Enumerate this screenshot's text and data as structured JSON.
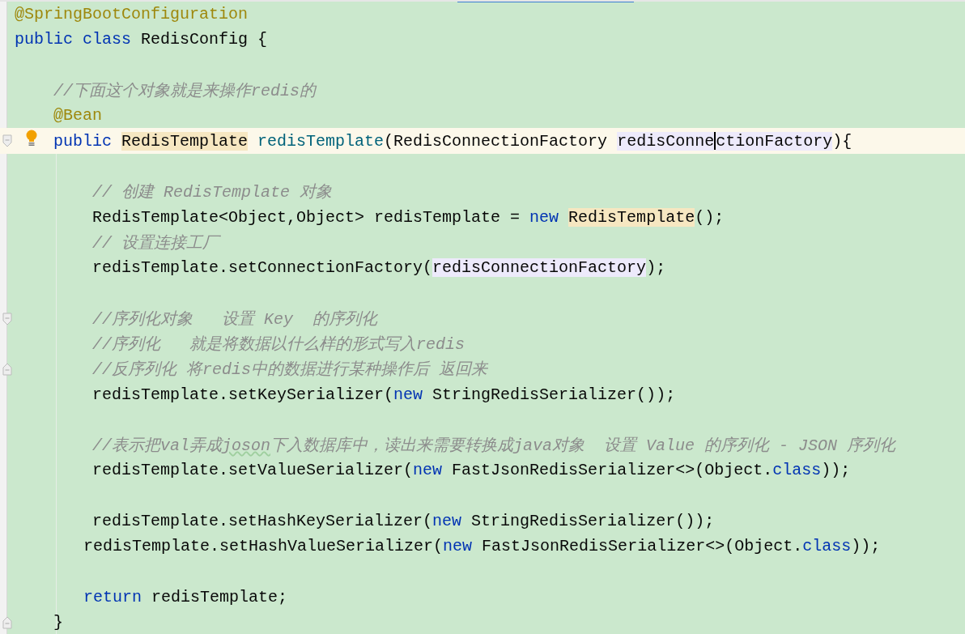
{
  "editor": {
    "lines": [
      {
        "kind": "outer",
        "current": false,
        "segments": [
          {
            "kind": "annotation",
            "text": "@SpringBootConfiguration"
          }
        ]
      },
      {
        "kind": "outer",
        "current": false,
        "segments": [
          {
            "kind": "keyword",
            "text": "public class "
          },
          {
            "kind": "plain",
            "text": "RedisConfig {"
          }
        ]
      },
      {
        "kind": "blank",
        "current": false
      },
      {
        "kind": "member",
        "current": false,
        "segments": [
          {
            "kind": "comment",
            "text": "//下面这个对象就是来操作redis的"
          }
        ]
      },
      {
        "kind": "member",
        "current": false,
        "segments": [
          {
            "kind": "annotation",
            "text": "@Bean"
          }
        ]
      },
      {
        "kind": "member",
        "current": true,
        "fold_start": true,
        "segments": [
          {
            "kind": "keyword",
            "text": "public "
          },
          {
            "kind": "usage",
            "text": "RedisTemplate"
          },
          {
            "kind": "method",
            "text": " redisTemplate"
          },
          {
            "kind": "plain",
            "text": "(RedisConnectionFactory "
          },
          {
            "kind": "param",
            "text": "redisConne"
          },
          {
            "kind": "caret"
          },
          {
            "kind": "param",
            "text": "ctionFactory"
          },
          {
            "kind": "plain",
            "text": "){"
          }
        ]
      },
      {
        "kind": "blank",
        "current": false
      },
      {
        "kind": "body",
        "current": false,
        "segments": [
          {
            "kind": "comment",
            "text": "// 创建 RedisTemplate 对象"
          }
        ]
      },
      {
        "kind": "body",
        "current": false,
        "segments": [
          {
            "kind": "plain",
            "text": "RedisTemplate<Object,Object> redisTemplate = "
          },
          {
            "kind": "keyword",
            "text": "new "
          },
          {
            "kind": "usage",
            "text": "RedisTemplate"
          },
          {
            "kind": "plain",
            "text": "();"
          }
        ]
      },
      {
        "kind": "body",
        "current": false,
        "segments": [
          {
            "kind": "comment",
            "text": "// 设置连接工厂"
          }
        ]
      },
      {
        "kind": "body",
        "current": false,
        "segments": [
          {
            "kind": "plain",
            "text": "redisTemplate.setConnectionFactory("
          },
          {
            "kind": "param",
            "text": "redisConnectionFactory"
          },
          {
            "kind": "plain",
            "text": ");"
          }
        ]
      },
      {
        "kind": "blank",
        "current": false
      },
      {
        "kind": "body",
        "current": false,
        "fold_start": true,
        "segments": [
          {
            "kind": "comment",
            "text": "//序列化对象   设置 Key  的序列化"
          }
        ]
      },
      {
        "kind": "body",
        "current": false,
        "segments": [
          {
            "kind": "comment",
            "text": "//序列化   就是将数据以什么样的形式写入redis"
          }
        ]
      },
      {
        "kind": "body",
        "current": false,
        "fold_end": true,
        "segments": [
          {
            "kind": "comment",
            "text": "//反序列化 将redis中的数据进行某种操作后 返回来"
          }
        ]
      },
      {
        "kind": "body",
        "current": false,
        "segments": [
          {
            "kind": "plain",
            "text": "redisTemplate.setKeySerializer("
          },
          {
            "kind": "keyword",
            "text": "new"
          },
          {
            "kind": "plain",
            "text": " StringRedisSerializer());"
          }
        ]
      },
      {
        "kind": "blank",
        "current": false
      },
      {
        "kind": "body",
        "current": false,
        "segments": [
          {
            "kind": "comment",
            "text": "//表示把val弄成"
          },
          {
            "kind": "typo",
            "text": "joson"
          },
          {
            "kind": "comment",
            "text": "下入数据库中，读出来需要转换成java对象  设置 Value 的序列化 - JSON 序列化"
          }
        ]
      },
      {
        "kind": "body",
        "current": false,
        "segments": [
          {
            "kind": "plain",
            "text": "redisTemplate.setValueSerializer("
          },
          {
            "kind": "keyword",
            "text": "new"
          },
          {
            "kind": "plain",
            "text": " FastJsonRedisSerializer<>(Object."
          },
          {
            "kind": "keyword",
            "text": "class"
          },
          {
            "kind": "plain",
            "text": "));"
          }
        ]
      },
      {
        "kind": "blank",
        "current": false
      },
      {
        "kind": "body",
        "current": false,
        "segments": [
          {
            "kind": "plain",
            "text": "redisTemplate.setHashKeySerializer("
          },
          {
            "kind": "keyword",
            "text": "new"
          },
          {
            "kind": "plain",
            "text": " StringRedisSerializer());"
          }
        ]
      },
      {
        "kind": "shifted",
        "current": false,
        "segments": [
          {
            "kind": "plain",
            "text": "redisTemplate.setHashValueSerializer("
          },
          {
            "kind": "keyword",
            "text": "new"
          },
          {
            "kind": "plain",
            "text": " FastJsonRedisSerializer<>(Object."
          },
          {
            "kind": "keyword",
            "text": "class"
          },
          {
            "kind": "plain",
            "text": "));"
          }
        ]
      },
      {
        "kind": "blank",
        "current": false
      },
      {
        "kind": "shifted",
        "current": false,
        "segments": [
          {
            "kind": "keyword",
            "text": "return"
          },
          {
            "kind": "plain",
            "text": " redisTemplate;"
          }
        ]
      },
      {
        "kind": "member",
        "current": false,
        "fold_end": true,
        "segments": [
          {
            "kind": "plain",
            "text": "}"
          }
        ]
      }
    ]
  }
}
